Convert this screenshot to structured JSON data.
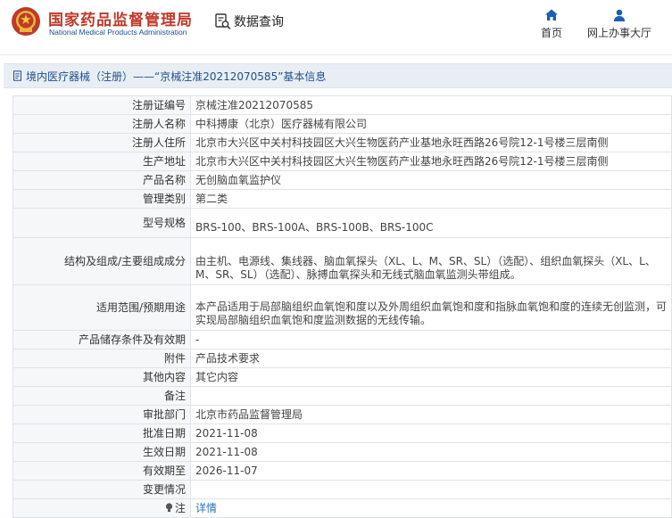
{
  "header": {
    "logo_cn": "国家药品监督管理局",
    "logo_en": "National Medical Products Administration",
    "query_label": "数据查询",
    "nav": [
      {
        "icon": "home-icon",
        "label": "首页"
      },
      {
        "icon": "user-icon",
        "label": "网上办事大厅"
      }
    ]
  },
  "breadcrumb": "境内医疗器械（注册）——“京械注准20212070585”基本信息",
  "fields": [
    {
      "label": "注册证编号",
      "value": "京械注准20212070585"
    },
    {
      "label": "注册人名称",
      "value": "中科搏康（北京）医疗器械有限公司"
    },
    {
      "label": "注册人住所",
      "value": "北京市大兴区中关村科技园区大兴生物医药产业基地永旺西路26号院12-1号楼三层南侧"
    },
    {
      "label": "生产地址",
      "value": "北京市大兴区中关村科技园区大兴生物医药产业基地永旺西路26号院12-1号楼三层南侧"
    },
    {
      "label": "产品名称",
      "value": "无创脑血氧监护仪"
    },
    {
      "label": "管理类别",
      "value": "第二类"
    },
    {
      "label": "型号规格",
      "value": "BRS-100、BRS-100A、BRS-100B、BRS-100C"
    },
    {
      "label": "结构及组成/主要组成成分",
      "value": "由主机、电源线、集线器、脑血氧探头（XL、L、M、SR、SL）（选配）、组织血氧探头（XL、L、M、SR、SL）（选配）、脉搏血氧探头和无线式脑血氧监测头带组成。"
    },
    {
      "label": "适用范围/预期用途",
      "value": "本产品适用于局部脑组织血氧饱和度以及外周组织血氧饱和度和指脉血氧饱和度的连续无创监测，可实现局部脑组织血氧饱和度监测数据的无线传输。"
    },
    {
      "label": "产品储存条件及有效期",
      "value": "-"
    },
    {
      "label": "附件",
      "value": "产品技术要求"
    },
    {
      "label": "其他内容",
      "value": "其它内容"
    },
    {
      "label": "备注",
      "value": ""
    },
    {
      "label": "审批部门",
      "value": "北京市药品监督管理局"
    },
    {
      "label": "批准日期",
      "value": "2021-11-08"
    },
    {
      "label": "生效日期",
      "value": "2021-11-08"
    },
    {
      "label": "有效期至",
      "value": "2026-11-07"
    },
    {
      "label": "变更情况",
      "value": ""
    },
    {
      "label": "注",
      "value": "详情"
    }
  ],
  "colors": {
    "brand_red": "#c0392b",
    "brand_blue": "#1c4e8c",
    "link_blue": "#2a6fbd",
    "label_bg": "#f6f7f9",
    "border": "#dfe3e8"
  }
}
